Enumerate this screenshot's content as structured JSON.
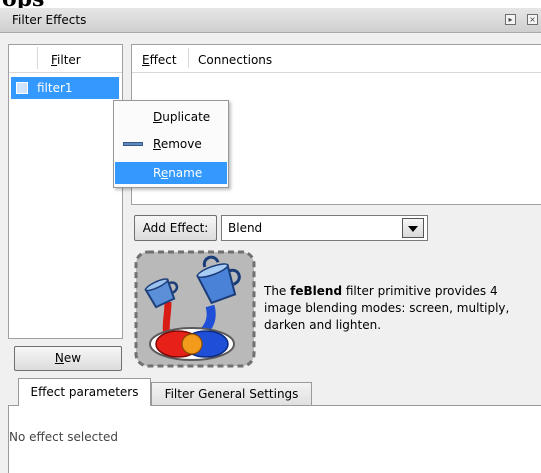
{
  "page_header": {
    "cut_text": "ops"
  },
  "window": {
    "title": "Filter Effects",
    "pin_button_glyph": "▸",
    "close_button_glyph": "×"
  },
  "filter_list": {
    "column_header": "Filter",
    "items": [
      {
        "label": "filter1",
        "selected": true
      }
    ],
    "new_button_label": "New"
  },
  "context_menu": {
    "items": [
      {
        "label": "Duplicate",
        "mnemonic_index": 0
      },
      {
        "label": "Remove",
        "mnemonic_index": 0,
        "icon": "remove-icon"
      },
      {
        "label": "Rename",
        "mnemonic_index": 1,
        "highlighted": true
      }
    ]
  },
  "effects": {
    "columns": [
      "Effect",
      "Connections"
    ],
    "add_effect_label": "Add Effect:",
    "selected_effect": "Blend",
    "description_prefix": "The ",
    "description_bold": "feBlend",
    "description_suffix": " filter primitive provides 4 image blending modes: screen, multiply, darken and lighten.",
    "icon": "blend-icon"
  },
  "bottom_tabs": {
    "tabs": [
      "Effect parameters",
      "Filter General Settings"
    ],
    "active_tab": 0,
    "content_text": "No effect selected"
  },
  "colors": {
    "selection": "#3399ff",
    "panel_bg": "#f0f0f0",
    "blend_red": "#e8201a",
    "blend_blue": "#1f4fd6",
    "blend_orange": "#f29b1a"
  }
}
